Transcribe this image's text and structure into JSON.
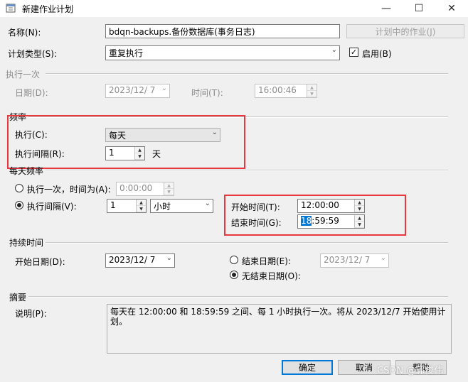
{
  "window": {
    "title": "新建作业计划",
    "minimize": "—",
    "maximize": "☐",
    "close": "✕"
  },
  "form": {
    "name_label": "名称(N):",
    "name_value": "bdqn-backups.备份数据库(事务日志)",
    "jobs_in_schedule_button": "计划中的作业(J)",
    "schedule_type_label": "计划类型(S):",
    "schedule_type_value": "重复执行",
    "enabled_label": "启用(B)",
    "enabled_checked": true
  },
  "one_time": {
    "section_title": "执行一次",
    "date_label": "日期(D):",
    "date_value": "2023/12/ 7",
    "time_label": "时间(T):",
    "time_value": "16:00:46"
  },
  "frequency": {
    "section_title": "频率",
    "occurs_label": "执行(C):",
    "occurs_value": "每天",
    "recurs_label": "执行间隔(R):",
    "recurs_value": "1",
    "recurs_unit": "天"
  },
  "daily_frequency": {
    "section_title": "每天频率",
    "once_label": "执行一次，时间为(A):",
    "once_value": "0:00:00",
    "every_label": "执行间隔(V):",
    "every_value": "1",
    "every_unit": "小时",
    "start_label": "开始时间(T):",
    "start_value": "12:00:00",
    "end_label": "结束时间(G):",
    "end_value_hour": "18",
    "end_value_rest": ":59:59",
    "selected_option": "every"
  },
  "duration": {
    "section_title": "持续时间",
    "start_date_label": "开始日期(D):",
    "start_date_value": "2023/12/ 7",
    "end_date_label": "结束日期(E):",
    "end_date_value": "2023/12/ 7",
    "no_end_label": "无结束日期(O):",
    "selected_option": "no_end"
  },
  "summary": {
    "section_title": "摘要",
    "description_label": "说明(P):",
    "description_text": "每天在 12:00:00 和 18:59:59 之间、每 1 小时执行一次。将从 2023/12/7 开始使用计划。"
  },
  "buttons": {
    "ok": "确定",
    "cancel": "取消",
    "help": "帮助"
  },
  "watermark": "CSDN @郭俊伟",
  "colors": {
    "highlight_box": "#e8383d",
    "selection": "#0078d7",
    "client_bg": "#f0f0f0"
  }
}
